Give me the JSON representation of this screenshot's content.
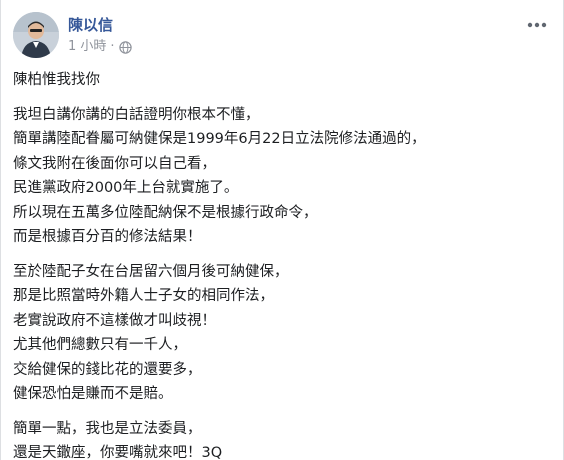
{
  "post": {
    "author": "陳以信",
    "time": "1 小時",
    "separator": "·",
    "privacy_icon": "globe-icon",
    "more_icon": "more-horizontal-icon",
    "paragraphs": [
      [
        "陳柏惟我找你"
      ],
      [
        "我坦白講你講的白話證明你根本不懂，",
        "簡單講陸配眷屬可納健保是1999年6月22日立法院修法通過的，",
        "條文我附在後面你可以自己看，",
        "民進黨政府2000年上台就實施了。",
        "所以現在五萬多位陸配納保不是根據行政命令，",
        "而是根據百分百的修法結果！"
      ],
      [
        "至於陸配子女在台居留六個月後可納健保，",
        "那是比照當時外籍人士子女的相同作法，",
        "老實說政府不這樣做才叫歧視！",
        "尤其他們總數只有一千人，",
        "交給健保的錢比花的還要多，",
        "健保恐怕是賺而不是賠。"
      ],
      [
        "簡單一點，我也是立法委員，",
        "還是天鏾座，你要嘴就來吧！3Q"
      ]
    ]
  },
  "colors": {
    "author": "#365899",
    "meta": "#90949c",
    "text": "#1c1e21"
  }
}
